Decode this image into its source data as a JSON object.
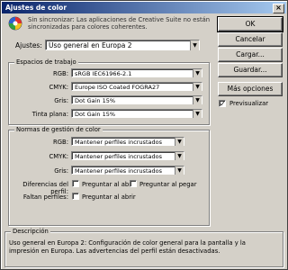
{
  "window": {
    "title": "Ajustes de color"
  },
  "notice": {
    "line1": "Sin sincronizar: Las aplicaciones de Creative Suite no están",
    "line2": "sincronizadas para colores coherentes."
  },
  "settings": {
    "label": "Ajustes:",
    "value": "Uso general en Europa 2"
  },
  "buttons": {
    "ok": "OK",
    "cancel": "Cancelar",
    "load": "Cargar...",
    "save": "Guardar...",
    "more_options": "Más opciones",
    "preview_label": "Previsualizar",
    "preview_checked": "✓"
  },
  "working_spaces": {
    "title": "Espacios de trabajo",
    "rows": [
      {
        "label": "RGB:",
        "value": "sRGB IEC61966-2.1"
      },
      {
        "label": "CMYK:",
        "value": "Europe ISO Coated FOGRA27"
      },
      {
        "label": "Gris:",
        "value": "Dot Gain 15%"
      },
      {
        "label": "Tinta plana:",
        "value": "Dot Gain 15%"
      }
    ]
  },
  "color_management": {
    "title": "Normas de gestión de color",
    "rows": [
      {
        "label": "RGB:",
        "value": "Mantener perfiles incrustados"
      },
      {
        "label": "CMYK:",
        "value": "Mantener perfiles incrustados"
      },
      {
        "label": "Gris:",
        "value": "Mantener perfiles incrustados"
      }
    ],
    "mismatch_label": "Diferencias del perfil:",
    "ask_open": "Preguntar al abrir",
    "ask_paste": "Preguntar al pegar",
    "missing_label": "Faltan perfiles:",
    "missing_ask_open": "Preguntar al abrir"
  },
  "description": {
    "title": "Descripción",
    "line1": "Uso general en Europa 2:  Configuración de color general para la pantalla y la",
    "line2": "impresión en Europa. Las advertencias del perfil están desactivadas."
  }
}
